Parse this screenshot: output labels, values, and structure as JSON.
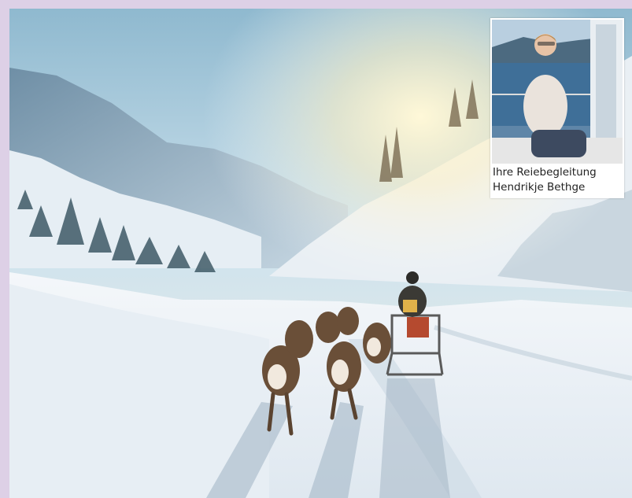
{
  "caption": {
    "line1": "Ihre Reiebegleitung",
    "line2": "Hendrikje Bethge"
  },
  "colors": {
    "frame": "#ddd0e6",
    "snow": "#eef4f9",
    "sky": "#cfe3ee"
  },
  "icons": {
    "photo": "winter-landscape-with-dog-sled",
    "portrait": "person-portrait"
  }
}
